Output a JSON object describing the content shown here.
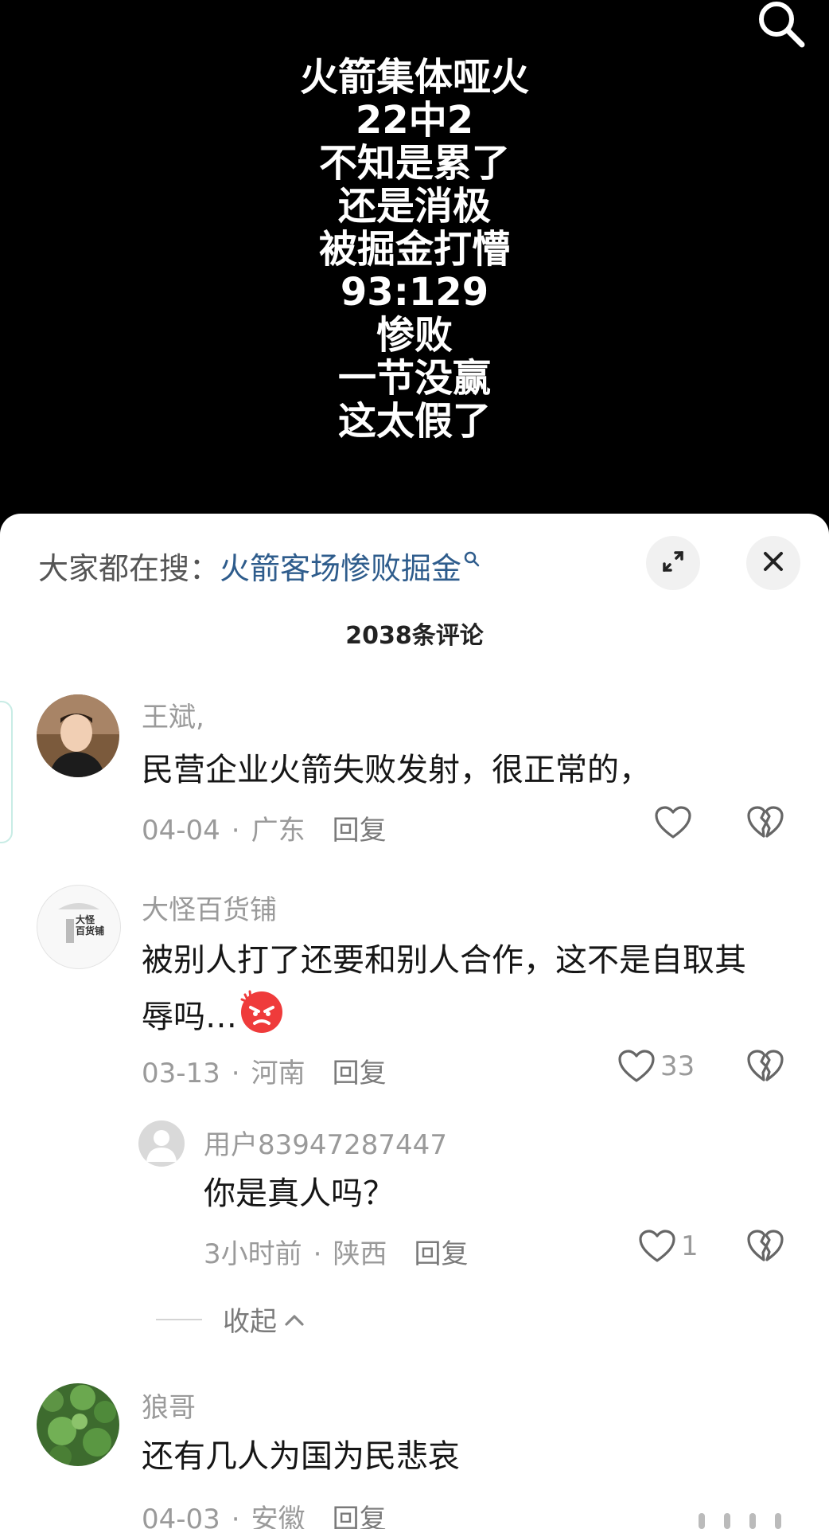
{
  "video": {
    "overlay_lines": [
      "火箭集体哑火",
      "22中2",
      "不知是累了",
      "还是消极",
      "被掘金打懵",
      "93:129",
      "惨败",
      "一节没赢",
      "这太假了"
    ]
  },
  "sheet": {
    "hot_search_prefix": "大家都在搜：",
    "hot_search_keyword": "火箭客场惨败掘金",
    "comment_count": "2038条评论",
    "collapse_label": "收起"
  },
  "comments": [
    {
      "user": "王斌,",
      "text": "民营企业火箭失败发射，很正常的，",
      "date": "04-04",
      "region": "广东",
      "reply": "回复",
      "likes": ""
    },
    {
      "user": "大怪百货铺",
      "avatar_text_1": "大怪",
      "avatar_text_2": "百货铺",
      "text_line1": "被别人打了还要和别人合作，这不是自取其",
      "text_line2": "辱吗…",
      "date": "03-13",
      "region": "河南",
      "reply": "回复",
      "likes": "33"
    },
    {
      "user": "用户83947287447",
      "text": "你是真人吗？",
      "date": "3小时前",
      "region": "陕西",
      "reply": "回复",
      "likes": "1"
    },
    {
      "user": "狼哥",
      "text": "还有几人为国为民悲哀",
      "date": "04-03",
      "region": "安徽",
      "reply": "回复",
      "likes": ""
    }
  ],
  "icons": [
    "search-icon",
    "expand-icon",
    "close-icon",
    "heart-icon",
    "broken-heart-icon",
    "chevron-up-icon",
    "angry-emoji-icon"
  ]
}
